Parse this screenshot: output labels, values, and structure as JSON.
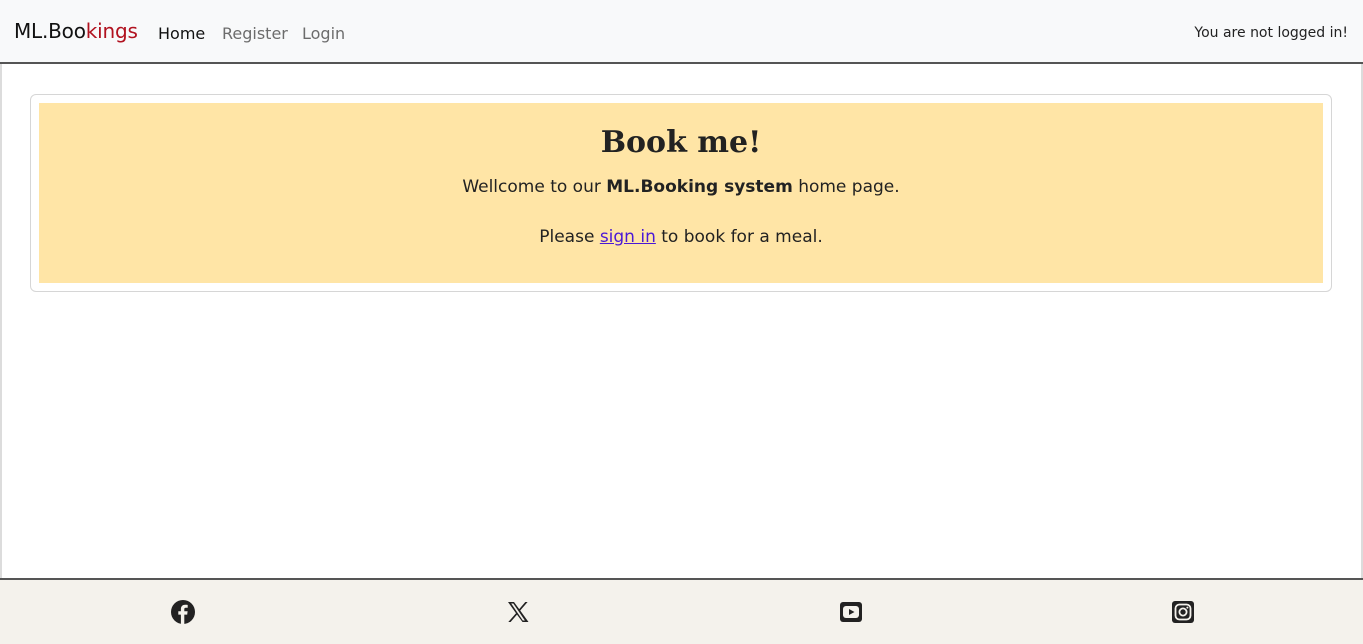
{
  "navbar": {
    "brand_part1": "ML.Boo",
    "brand_part2": "kings",
    "links": [
      "Home",
      "Register",
      "Login"
    ],
    "status": "You are not logged in!"
  },
  "card": {
    "title": "Book me!",
    "welcome_pre": "Wellcome to our ",
    "welcome_bold": "ML.Booking system",
    "welcome_post": " home page.",
    "please_pre": "Please ",
    "please_link": "sign in",
    "please_post": " to book for a meal."
  },
  "footer": {
    "icons": [
      "facebook-icon",
      "x-twitter-icon",
      "youtube-icon",
      "instagram-icon"
    ]
  },
  "colors": {
    "brand_accent": "#b1121f",
    "card_background": "#ffe5a6",
    "link": "#4a18d6",
    "footer_background": "#f4f2ec"
  }
}
